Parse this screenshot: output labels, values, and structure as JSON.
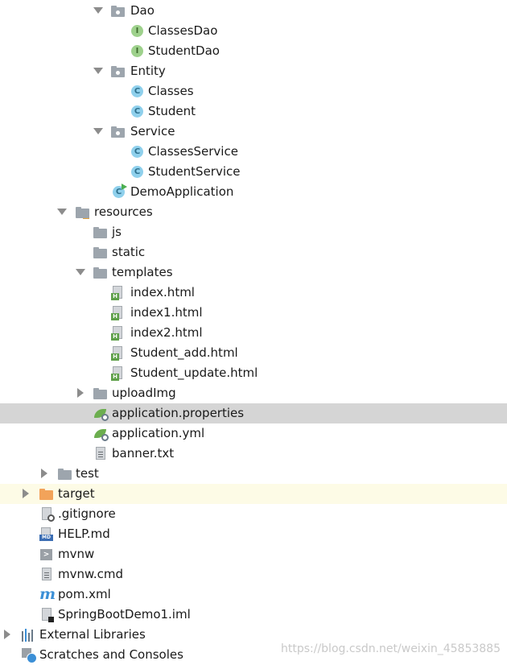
{
  "tree": {
    "dao": "Dao",
    "classes_dao": "ClassesDao",
    "student_dao": "StudentDao",
    "entity": "Entity",
    "classes": "Classes",
    "student": "Student",
    "service": "Service",
    "classes_service": "ClassesService",
    "student_service": "StudentService",
    "demo_application": "DemoApplication",
    "resources": "resources",
    "js": "js",
    "static": "static",
    "templates": "templates",
    "index_html": "index.html",
    "index1_html": "index1.html",
    "index2_html": "index2.html",
    "student_add_html": "Student_add.html",
    "student_update_html": "Student_update.html",
    "upload_img": "uploadImg",
    "application_properties": "application.properties",
    "application_yml": "application.yml",
    "banner_txt": "banner.txt",
    "test": "test",
    "target": "target",
    "gitignore": ".gitignore",
    "help_md": "HELP.md",
    "mvnw": "mvnw",
    "mvnw_cmd": "mvnw.cmd",
    "pom_xml": "pom.xml",
    "iml": "SpringBootDemo1.iml",
    "external_libraries": "External Libraries",
    "scratches": "Scratches and Consoles"
  },
  "icons": {
    "interface_letter": "I",
    "class_letter": "C",
    "html_letter": "H",
    "md_letter": "MD",
    "terminal_glyph": ">",
    "maven_letter": "m"
  },
  "watermark": "https://blog.csdn.net/weixin_45853885"
}
